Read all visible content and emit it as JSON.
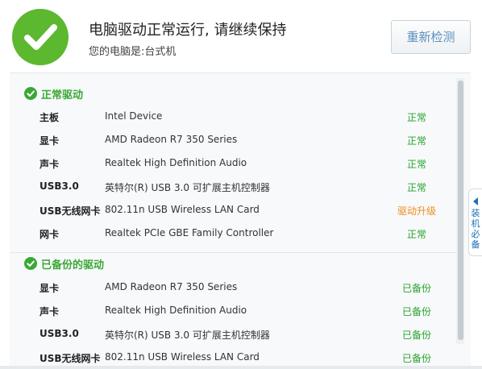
{
  "header": {
    "title": "电脑驱动正常运行, 请继续保持",
    "subtitle": "您的电脑是:台式机",
    "rescan_label": "重新检测"
  },
  "sections": {
    "normal": {
      "title": "正常驱动",
      "items": [
        {
          "name": "主板",
          "desc": "Intel Device",
          "status": "正常"
        },
        {
          "name": "显卡",
          "desc": "AMD Radeon R7 350 Series",
          "status": "正常"
        },
        {
          "name": "声卡",
          "desc": "Realtek High Definition Audio",
          "status": "正常"
        },
        {
          "name": "USB3.0",
          "desc": "英特尔(R) USB 3.0 可扩展主机控制器",
          "status": "正常"
        },
        {
          "name": "USB无线网卡",
          "desc": "802.11n USB Wireless LAN Card",
          "status": "驱动升级"
        },
        {
          "name": "网卡",
          "desc": "Realtek PCIe GBE Family Controller",
          "status": "正常"
        }
      ]
    },
    "backup": {
      "title": "已备份的驱动",
      "items": [
        {
          "name": "显卡",
          "desc": "AMD Radeon R7 350 Series",
          "status": "已备份"
        },
        {
          "name": "声卡",
          "desc": "Realtek High Definition Audio",
          "status": "已备份"
        },
        {
          "name": "USB3.0",
          "desc": "英特尔(R) USB 3.0 可扩展主机控制器",
          "status": "已备份"
        },
        {
          "name": "USB无线网卡",
          "desc": "802.11n USB Wireless LAN Card",
          "status": "已备份"
        }
      ]
    }
  },
  "side_tab": {
    "label": "装机必备"
  },
  "colors": {
    "accent_green": "#3aa835",
    "check_green": "#5cb82e",
    "upgrade_orange": "#f08c1e",
    "link_blue": "#5a8fbf"
  }
}
